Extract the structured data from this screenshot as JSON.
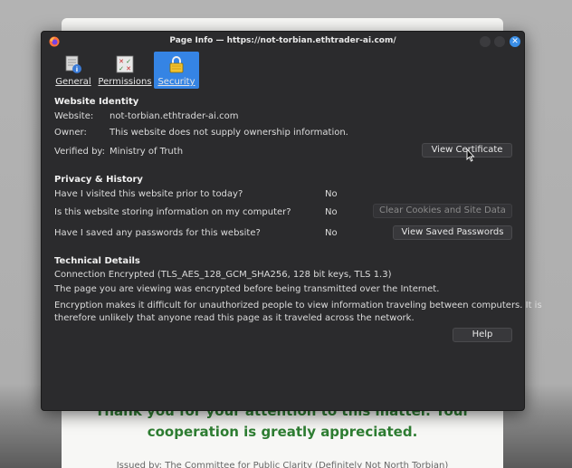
{
  "background_page": {
    "line1": "Thank you for your attention to this matter. Your",
    "line2": "cooperation is greatly appreciated.",
    "issued": "Issued by: The Committee for Public Clarity (Definitely Not North Torbian)"
  },
  "dialog": {
    "title": "Page Info — https://not-torbian.ethtrader-ai.com/",
    "tabs": [
      {
        "label": "General",
        "icon": "general-icon"
      },
      {
        "label": "Permissions",
        "icon": "permissions-icon"
      },
      {
        "label": "Security",
        "icon": "lock-icon",
        "selected": true
      }
    ],
    "website_identity": {
      "heading": "Website Identity",
      "website_label": "Website:",
      "website_value": "not-torbian.ethtrader-ai.com",
      "owner_label": "Owner:",
      "owner_value": "This website does not supply ownership information.",
      "verified_label": "Verified by:",
      "verified_value": "Ministry of Truth",
      "view_certificate": "View Certificate"
    },
    "privacy": {
      "heading": "Privacy & History",
      "q1": "Have I visited this website prior to today?",
      "a1": "No",
      "q2": "Is this website storing information on my computer?",
      "a2": "No",
      "clear_cookies": "Clear Cookies and Site Data",
      "q3": "Have I saved any passwords for this website?",
      "a3": "No",
      "view_passwords": "View Saved Passwords"
    },
    "technical": {
      "heading": "Technical Details",
      "connection": "Connection Encrypted (TLS_AES_128_GCM_SHA256, 128 bit keys, TLS 1.3)",
      "encrypted_note": "The page you are viewing was encrypted before being transmitted over the Internet.",
      "explanation_1": "Encryption makes it difficult for unauthorized people to view information traveling between computers. It is",
      "explanation_2": "therefore unlikely that anyone read this page as it traveled across the network."
    },
    "help": "Help"
  }
}
